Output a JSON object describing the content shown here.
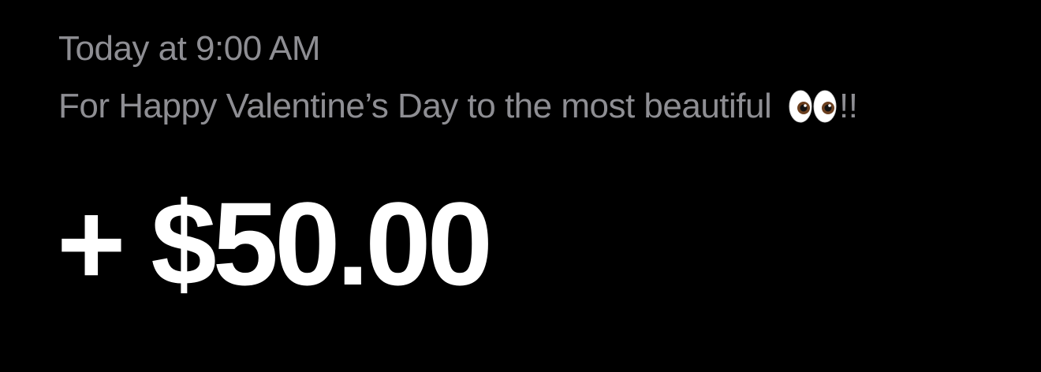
{
  "transaction": {
    "timestamp": "Today at 9:00 AM",
    "note_text": "For Happy Valentine’s Day to the most beautiful ",
    "note_emoji_icon": "eyes-emoji-icon",
    "note_suffix": "!!",
    "amount": "+ $50.00"
  },
  "colors": {
    "background": "#000000",
    "secondary_text": "#8e8e93",
    "amount_text": "#ffffff"
  }
}
